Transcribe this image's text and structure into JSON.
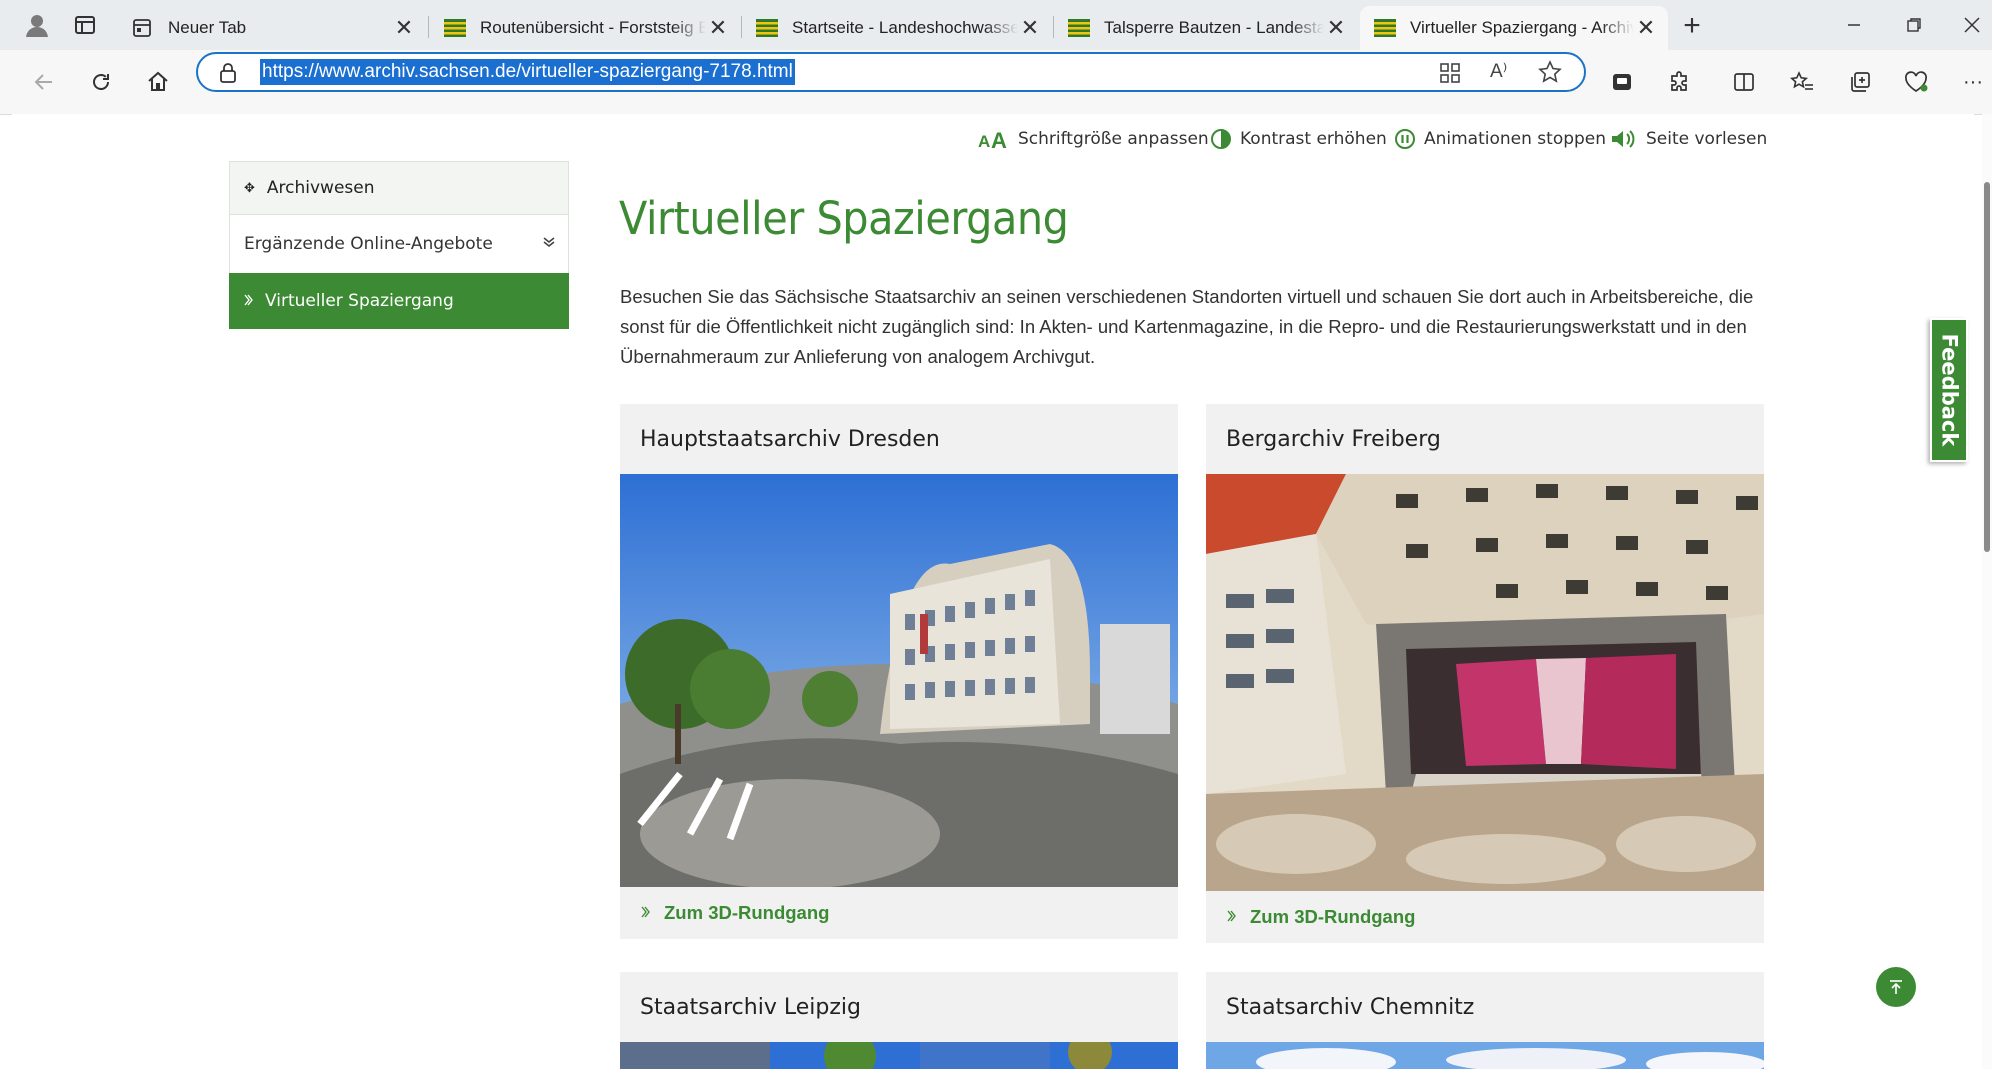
{
  "browser": {
    "tabs": [
      {
        "title": "Neuer Tab",
        "favicon": "newtab-icon"
      },
      {
        "title": "Routenübersicht - Forststeig Elbsandstein",
        "favicon": "saxony-crest-icon"
      },
      {
        "title": "Startseite - Landeshochwasserzentrum",
        "favicon": "saxony-crest-icon"
      },
      {
        "title": "Talsperre Bautzen - Landestalsperrenverwaltung",
        "favicon": "saxony-crest-icon"
      },
      {
        "title": "Virtueller Spaziergang - Archivwesen",
        "favicon": "saxony-crest-icon"
      }
    ],
    "active_tab_index": 4,
    "url": "https://www.archiv.sachsen.de/virtueller-spaziergang-7178.html"
  },
  "utility_bar": {
    "font_size": "Schriftgröße anpassen",
    "contrast": "Kontrast erhöhen",
    "animations": "Animationen stoppen",
    "read_aloud": "Seite vorlesen"
  },
  "sidenav": {
    "head": "Archivwesen",
    "item": "Ergänzende Online-Angebote",
    "active": "Virtueller Spaziergang"
  },
  "main": {
    "title": "Virtueller Spaziergang",
    "intro": "Besuchen Sie das Sächsische Staatsarchiv an seinen verschiedenen Standorten virtuell und schauen Sie dort auch in Arbeitsbereiche, die sonst für die Öffentlichkeit nicht zugänglich sind: In Akten- und Kartenmagazine, in die Repro- und die Restaurierungswerkstatt und in den Übernahmeraum zur Anlieferung von analogem Archivgut.",
    "cards": [
      {
        "title": "Hauptstaatsarchiv Dresden",
        "link": "Zum 3D-Rundgang"
      },
      {
        "title": "Bergarchiv Freiberg",
        "link": "Zum 3D-Rundgang"
      },
      {
        "title": "Staatsarchiv Leipzig"
      },
      {
        "title": "Staatsarchiv Chemnitz"
      }
    ]
  },
  "feedback": "Feedback",
  "colors": {
    "accent": "#3c8a33",
    "selection": "#1a6fd0"
  }
}
